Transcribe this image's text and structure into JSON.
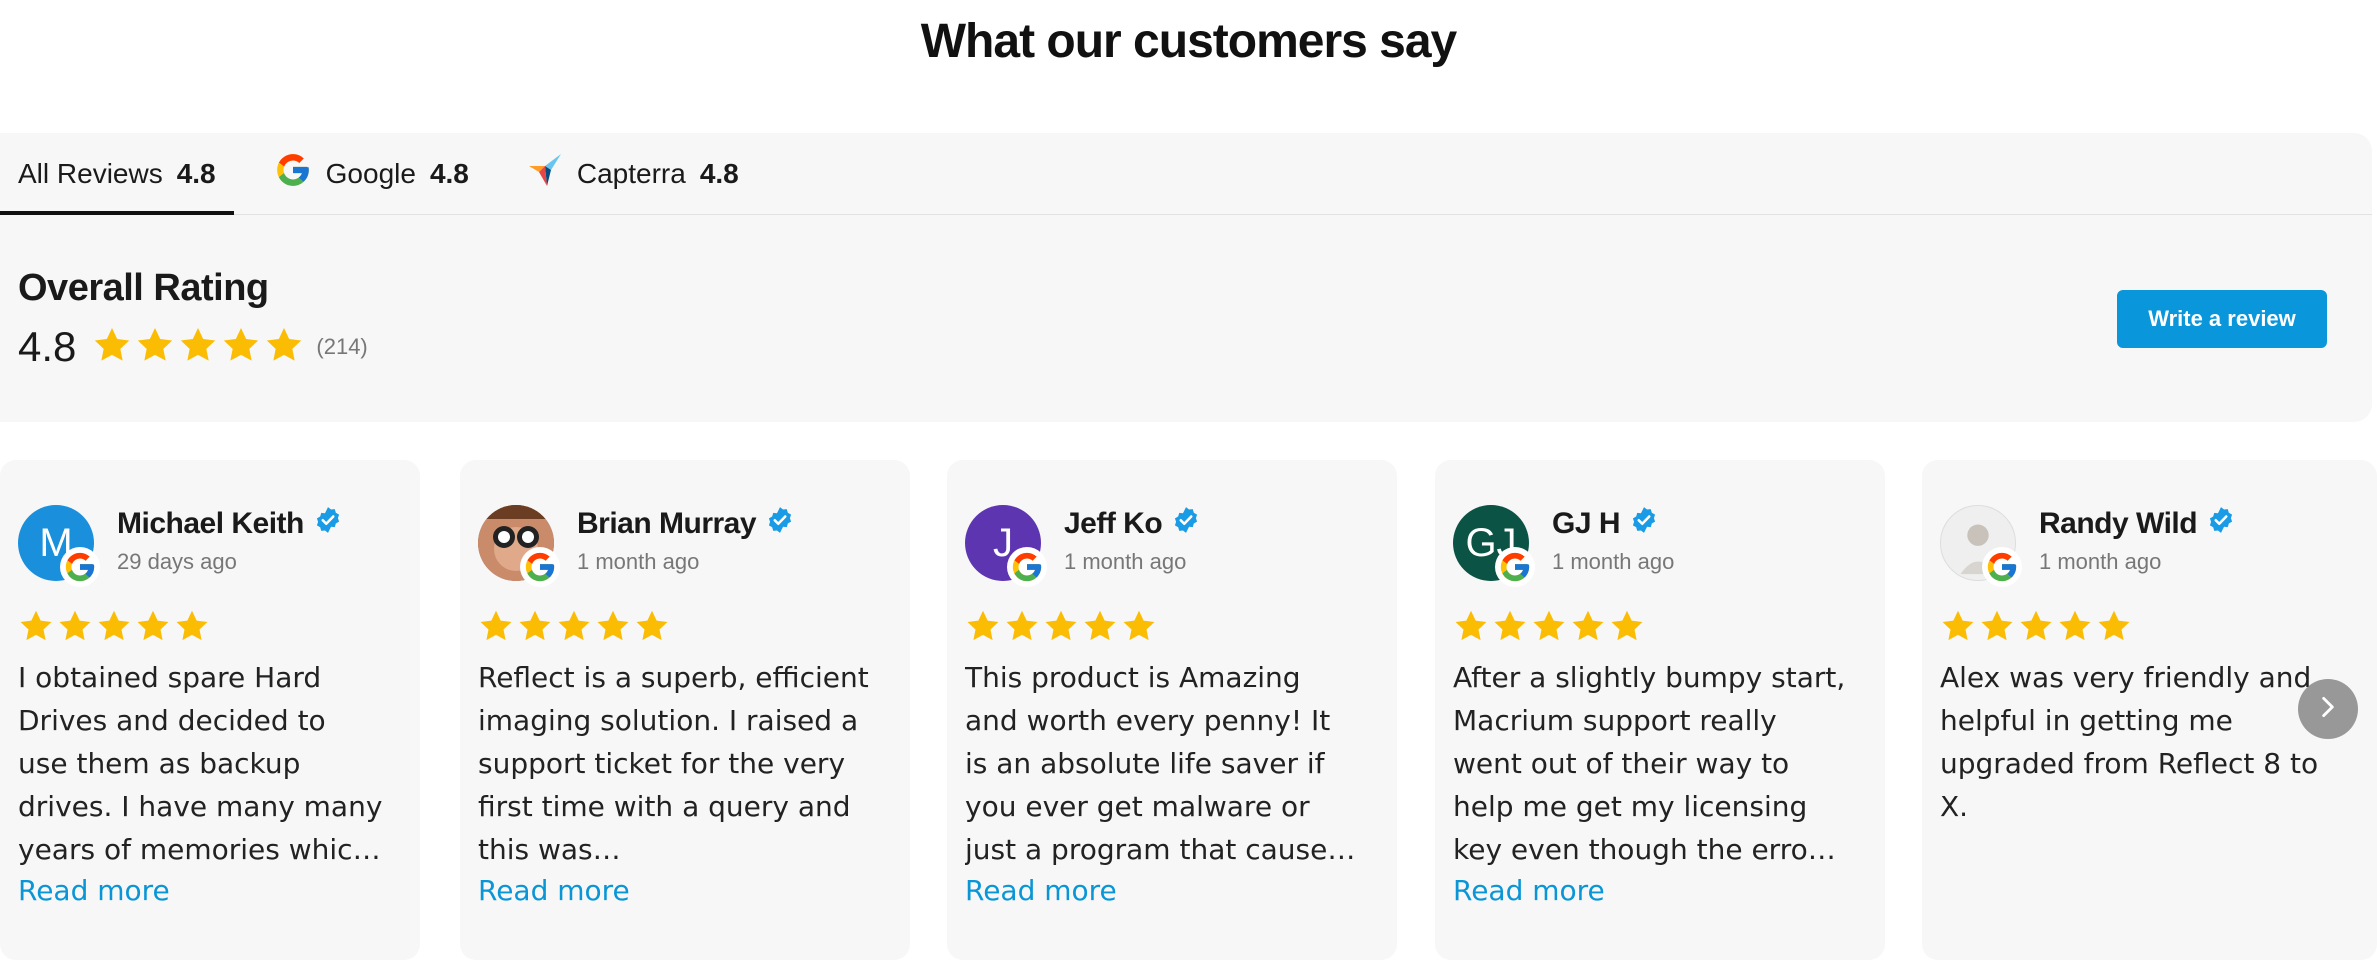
{
  "page_title": "What our customers say",
  "tabs": [
    {
      "label": "All Reviews",
      "score": "4.8",
      "icon": "none",
      "active": true
    },
    {
      "label": "Google",
      "score": "4.8",
      "icon": "google-icon",
      "active": false
    },
    {
      "label": "Capterra",
      "score": "4.8",
      "icon": "capterra-icon",
      "active": false
    }
  ],
  "overall": {
    "title": "Overall Rating",
    "score": "4.8",
    "stars": 5,
    "count": "(214)"
  },
  "write_review_label": "Write a review",
  "colors": {
    "star": "#fbbc04",
    "accent": "#0996db",
    "verified": "#1a9be6",
    "link": "#0a96d6"
  },
  "reviews": [
    {
      "name": "Michael Keith",
      "initial": "M",
      "avatar_color": "#1a8fdc",
      "avatar_type": "initial",
      "date": "29 days ago",
      "stars": 5,
      "text": "I obtained spare Hard Drives and decided to use them as backup drives. I have many many years of memories which I would…",
      "read_more": "Read more"
    },
    {
      "name": "Brian Murray",
      "initial": "",
      "avatar_color": "#8a5a3c",
      "avatar_type": "photo",
      "date": "1 month ago",
      "stars": 5,
      "text": "Reflect is a superb, efficient imaging solution. I raised a support ticket for the very first time with a query and this was…",
      "read_more": "Read more"
    },
    {
      "name": "Jeff Ko",
      "initial": "J",
      "avatar_color": "#5e35b1",
      "avatar_type": "initial",
      "date": "1 month ago",
      "stars": 5,
      "text": "This product is Amazing and worth every penny! It is an absolute life saver if you ever get malware or just a program that cause…",
      "read_more": "Read more"
    },
    {
      "name": "GJ H",
      "initial": "GJ",
      "avatar_color": "#0b5345",
      "avatar_type": "initial",
      "date": "1 month ago",
      "stars": 5,
      "text": "After a slightly bumpy start, Macrium support really went out of their way to help me get my licensing key even though the erro…",
      "read_more": "Read more"
    },
    {
      "name": "Randy Wild",
      "initial": "",
      "avatar_color": "#e6e6e6",
      "avatar_type": "photo-light",
      "date": "1 month ago",
      "stars": 5,
      "text": "Alex was very friendly and helpful in getting me upgraded from Reflect 8 to X.",
      "read_more": ""
    }
  ]
}
